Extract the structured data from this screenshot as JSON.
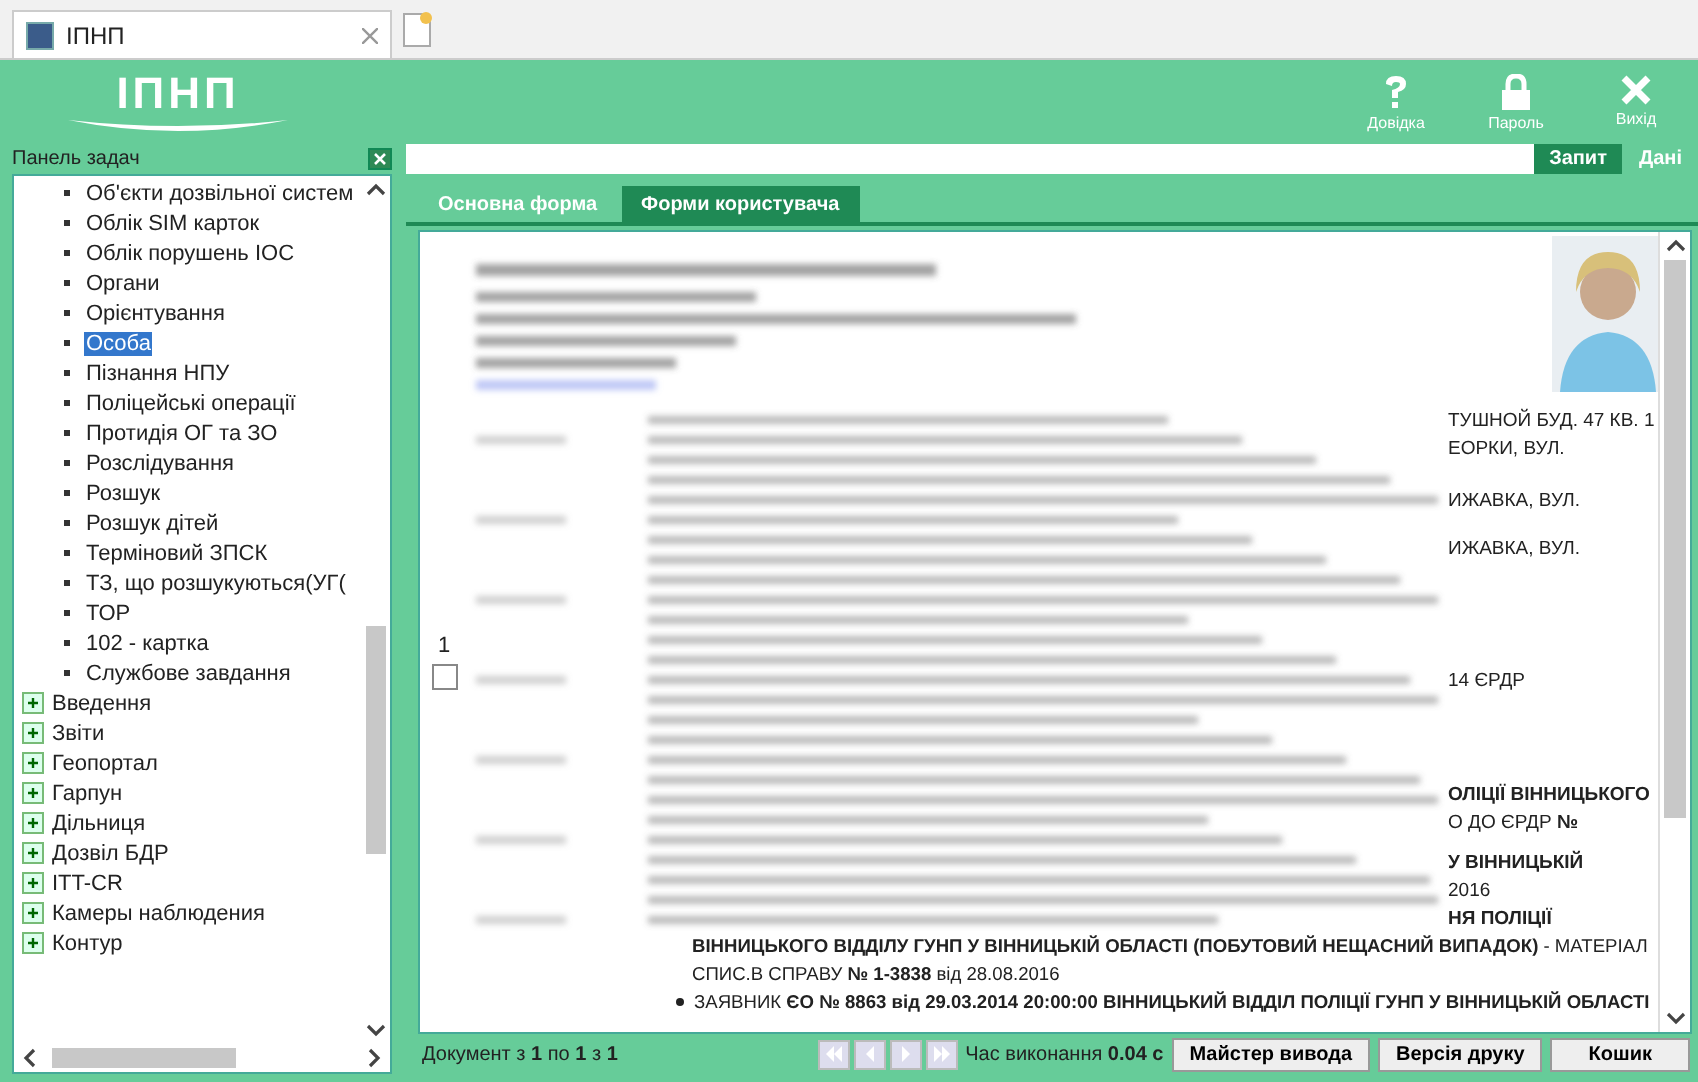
{
  "browser_tab": {
    "title": "ІПНП"
  },
  "header": {
    "logo": "ІПНП",
    "actions": [
      {
        "kind": "help",
        "label": "Довідка"
      },
      {
        "kind": "lock",
        "label": "Пароль"
      },
      {
        "kind": "exit",
        "label": "Вихід"
      }
    ]
  },
  "task_panel": {
    "title": "Панель задач",
    "items": [
      {
        "kind": "leaf",
        "label": "Об'єкти дозвільної систем",
        "selected": false
      },
      {
        "kind": "leaf",
        "label": "Облік SIM карток",
        "selected": false
      },
      {
        "kind": "leaf",
        "label": "Облік порушень ІОС",
        "selected": false
      },
      {
        "kind": "leaf",
        "label": "Органи",
        "selected": false
      },
      {
        "kind": "leaf",
        "label": "Орієнтування",
        "selected": false
      },
      {
        "kind": "leaf",
        "label": "Особа",
        "selected": true
      },
      {
        "kind": "leaf",
        "label": "Пізнання НПУ",
        "selected": false
      },
      {
        "kind": "leaf",
        "label": "Поліцейські операції",
        "selected": false
      },
      {
        "kind": "leaf",
        "label": "Протидія ОГ та ЗО",
        "selected": false
      },
      {
        "kind": "leaf",
        "label": "Розслідування",
        "selected": false
      },
      {
        "kind": "leaf",
        "label": "Розшук",
        "selected": false
      },
      {
        "kind": "leaf",
        "label": "Розшук дітей",
        "selected": false
      },
      {
        "kind": "leaf",
        "label": "Терміновий ЗПСК",
        "selected": false
      },
      {
        "kind": "leaf",
        "label": "ТЗ, що розшукуються(УГ(",
        "selected": false
      },
      {
        "kind": "leaf",
        "label": "ТОР",
        "selected": false
      },
      {
        "kind": "leaf",
        "label": "102 - картка",
        "selected": false
      },
      {
        "kind": "leaf",
        "label": "Службове завдання",
        "selected": false
      },
      {
        "kind": "group",
        "label": "Введення",
        "expanded": false
      },
      {
        "kind": "group",
        "label": "Звіти",
        "expanded": false
      },
      {
        "kind": "group",
        "label": "Геопортал",
        "expanded": false
      },
      {
        "kind": "group",
        "label": "Гарпун",
        "expanded": false
      },
      {
        "kind": "group",
        "label": "Дільниця",
        "expanded": false
      },
      {
        "kind": "group",
        "label": "Дозвіл БДР",
        "expanded": false
      },
      {
        "kind": "group",
        "label": "ITT-CR",
        "expanded": false
      },
      {
        "kind": "group",
        "label": "Камеры наблюдения",
        "expanded": false
      },
      {
        "kind": "group",
        "label": "Контур",
        "expanded": false
      }
    ]
  },
  "mode_buttons": [
    {
      "label": "Запит",
      "selected": false
    },
    {
      "label": "Дані",
      "selected": true
    }
  ],
  "form_tabs": [
    {
      "label": "Основна форма",
      "selected": true
    },
    {
      "label": "Форми користувача",
      "selected": false
    }
  ],
  "record": {
    "row_number": "1",
    "checked": false,
    "fragments": [
      "ТУШНОЙ БУД. 47 КВ. 1",
      "ЕОРКИ, ВУЛ.",
      "ИЖАВКА, ВУЛ.",
      "ИЖАВКА, ВУЛ.",
      "14 ЄРДР",
      "**ОЛІЦІЇ ВІННИЦЬКОГО**",
      "О ДО ЄРДР **№**",
      "**У ВІННИЦЬКІЙ**",
      "2016",
      "**НЯ ПОЛІЦІЇ**"
    ],
    "lines": [
      {
        "bullet": false,
        "text": "**ВІННИЦЬКОГО ВІДДІЛУ ГУНП У ВІННИЦЬКІЙ ОБЛАСТІ (ПОБУТОВИЙ НЕЩАСНИЙ ВИПАДОК)** - МАТЕРІАЛ"
      },
      {
        "bullet": false,
        "text": "СПИС.В СПРАВУ **№ 1-3838** від 28.08.2016"
      },
      {
        "bullet": true,
        "text": "ЗАЯВНИК **ЄО № 8863 від 29.03.2014 20:00:00 ВІННИЦЬКИЙ ВІДДІЛ ПОЛІЦІЇ ГУНП У ВІННИЦЬКІЙ ОБЛАСТІ**"
      }
    ]
  },
  "status_bar": {
    "paging": "Документ з **1** по **1** з **1**",
    "timing": "Час виконання **0.04 с**",
    "buttons": [
      "Майстер вивода",
      "Версія друку",
      "Кошик"
    ]
  }
}
